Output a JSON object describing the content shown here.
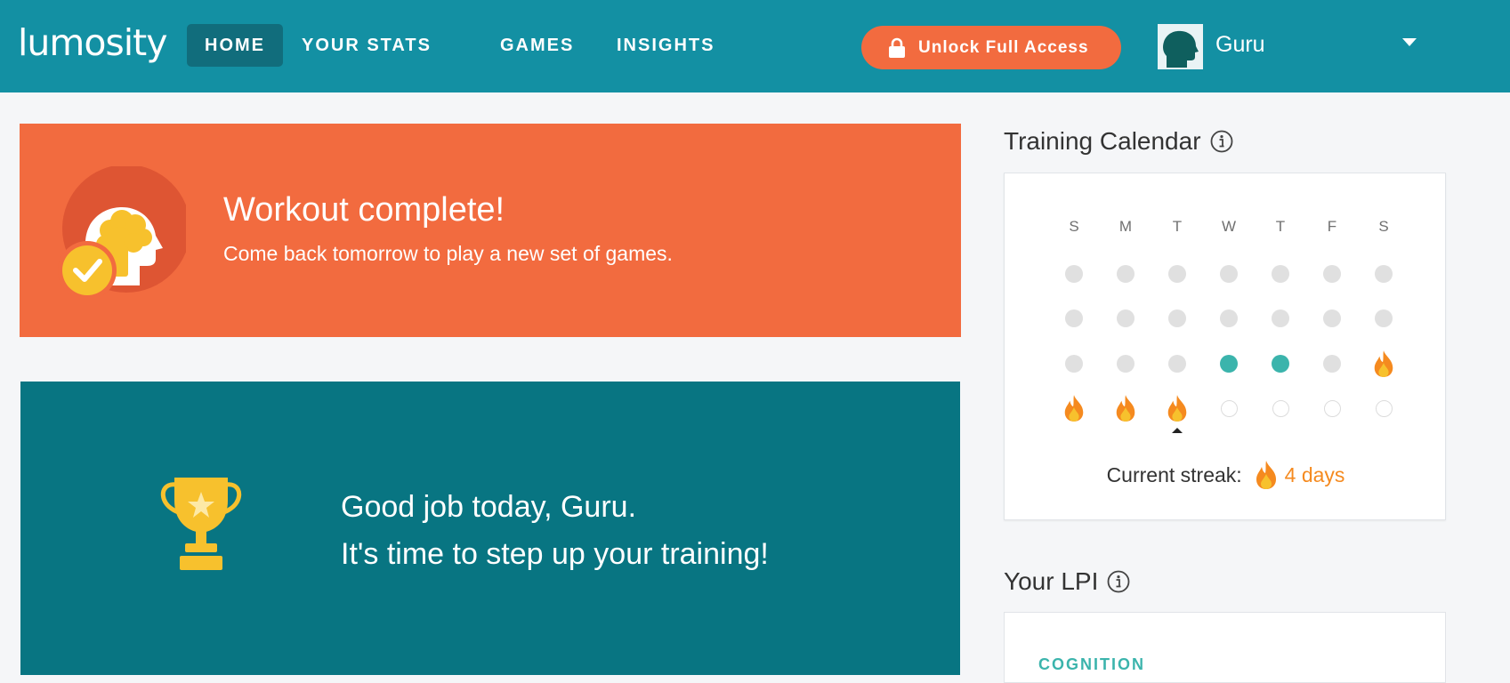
{
  "header": {
    "logo": "lumosity",
    "nav": [
      "HOME",
      "YOUR STATS",
      "GAMES",
      "INSIGHTS"
    ],
    "active_nav": "HOME",
    "unlock_label": "Unlock Full Access",
    "user_name": "Guru"
  },
  "colors": {
    "header_bg": "#1390a3",
    "nav_active_bg": "#116d7c",
    "accent_orange": "#f26b3f",
    "good_job_bg": "#087582",
    "trained_teal": "#3bb4ac",
    "flame_orange": "#f58a1f",
    "trophy_gold": "#f7c12d"
  },
  "workout": {
    "title": "Workout complete!",
    "subtitle": "Come back tomorrow to play a new set of games."
  },
  "good_job": {
    "line1": "Good job today, Guru.",
    "line2": "It's time to step up your training!"
  },
  "calendar": {
    "title": "Training Calendar",
    "days": [
      "S",
      "M",
      "T",
      "W",
      "T",
      "F",
      "S"
    ],
    "weeks": [
      [
        "none",
        "none",
        "none",
        "none",
        "none",
        "none",
        "none"
      ],
      [
        "none",
        "none",
        "none",
        "none",
        "none",
        "none",
        "none"
      ],
      [
        "none",
        "none",
        "none",
        "trained",
        "trained",
        "none",
        "streak"
      ],
      [
        "streak",
        "streak",
        "streak",
        "future",
        "future",
        "future",
        "future"
      ]
    ],
    "today_week": 3,
    "today_day": 2,
    "streak_label": "Current streak:",
    "streak_value": "4 days"
  },
  "lpi": {
    "title": "Your LPI",
    "category": "COGNITION"
  }
}
